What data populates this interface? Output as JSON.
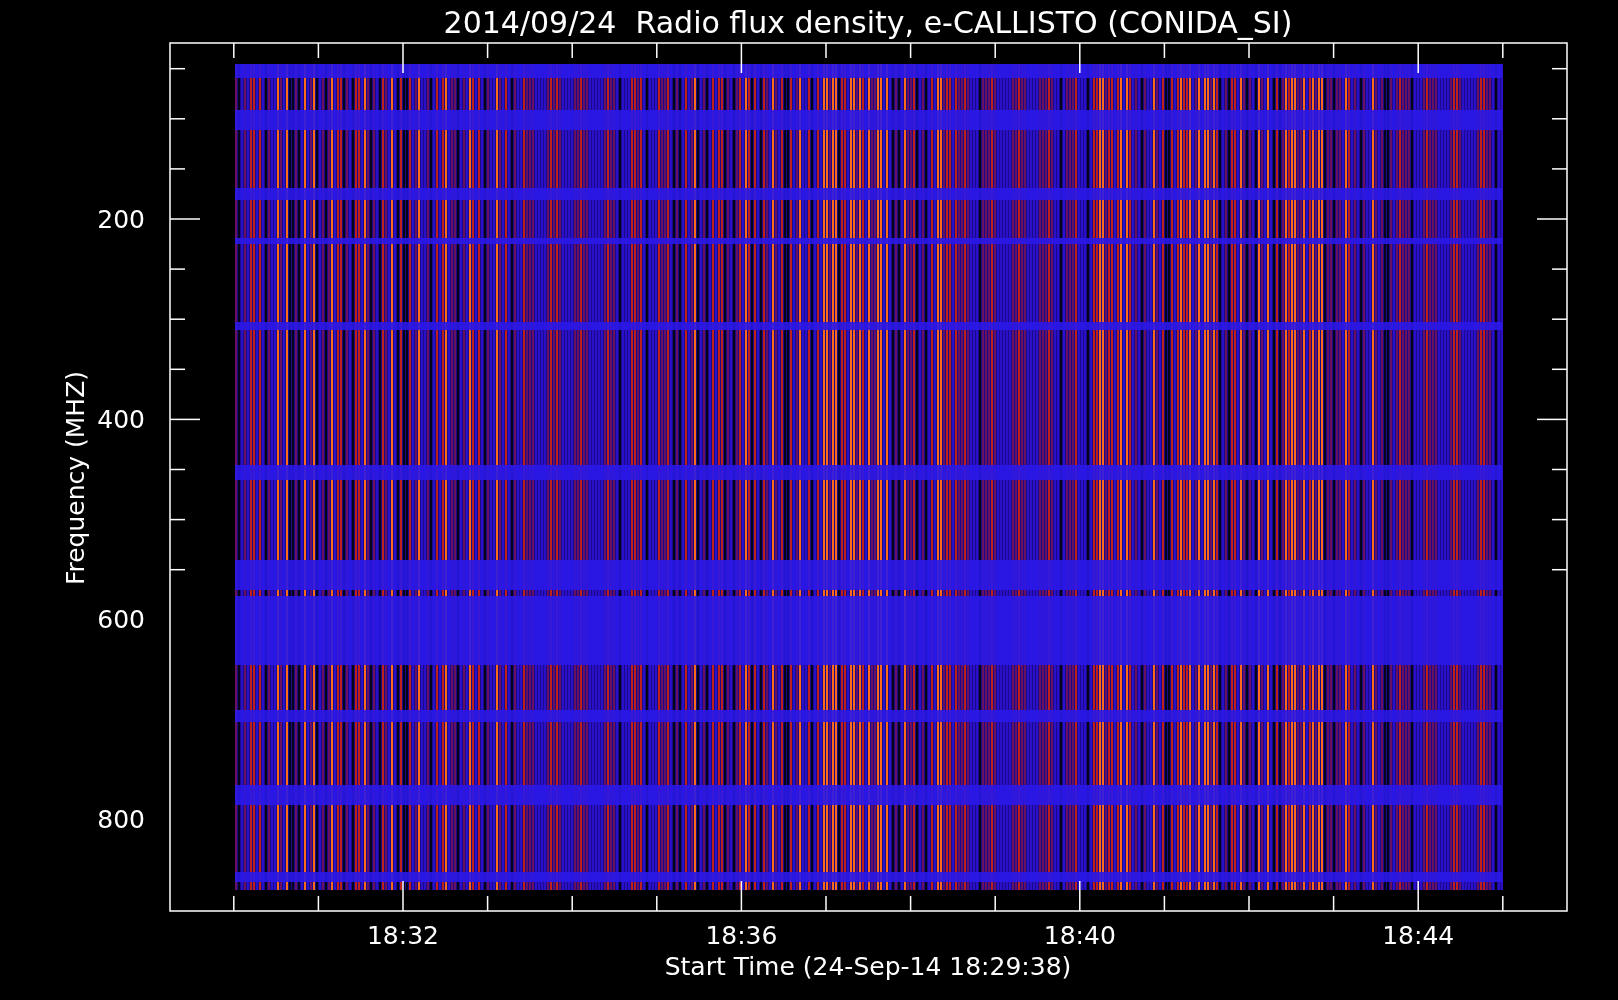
{
  "title": "2014/09/24  Radio flux density, e-CALLISTO (CONIDA_SI)",
  "ylabel": "Frequency (MHZ)",
  "xlabel": "Start Time (24-Sep-14 18:29:38)",
  "yticks": [
    "200",
    "400",
    "600",
    "800"
  ],
  "xticks": [
    "18:32",
    "18:36",
    "18:40",
    "18:44"
  ]
}
